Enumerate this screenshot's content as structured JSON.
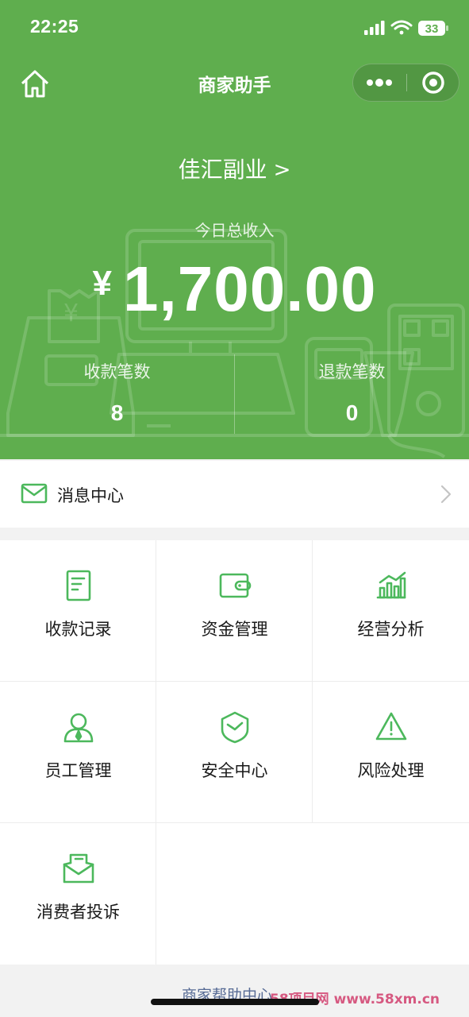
{
  "colors": {
    "brand_green": "#5fae4e",
    "icon_green": "#4cb85c",
    "link_blue": "#576b95"
  },
  "status_bar": {
    "time": "22:25",
    "battery": "33",
    "icons": [
      "cellular-signal-icon",
      "wifi-icon",
      "battery-icon"
    ]
  },
  "nav": {
    "title": "商家助手",
    "home_icon": "home-icon",
    "more_icon": "more-dots-icon",
    "close_icon": "target-circle-icon"
  },
  "hero": {
    "merchant_name": "佳汇副业",
    "merchant_chevron": ">",
    "income_label": "今日总收入",
    "currency": "¥",
    "income_amount": "1,700.00",
    "stats": [
      {
        "label": "收款笔数",
        "value": "8"
      },
      {
        "label": "退款笔数",
        "value": "0"
      }
    ]
  },
  "message_center": {
    "label": "消息中心",
    "icon": "envelope-icon"
  },
  "menu": [
    {
      "label": "收款记录",
      "icon": "receipt-record-icon"
    },
    {
      "label": "资金管理",
      "icon": "wallet-icon"
    },
    {
      "label": "经营分析",
      "icon": "bar-chart-icon"
    },
    {
      "label": "员工管理",
      "icon": "staff-person-icon"
    },
    {
      "label": "安全中心",
      "icon": "shield-icon"
    },
    {
      "label": "风险处理",
      "icon": "warning-triangle-icon"
    },
    {
      "label": "消费者投诉",
      "icon": "complaint-mail-icon"
    }
  ],
  "footer": {
    "help_link": "商家帮助中心",
    "watermark": "58项目网 www.58xm.cn"
  }
}
